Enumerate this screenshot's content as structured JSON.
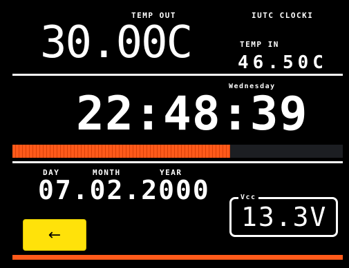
{
  "header": {
    "temp_out_label": "TEMP OUT",
    "clock_label": "IUTC CLOCKI",
    "temp_out_value": "30.00C",
    "temp_in_label": "TEMP IN",
    "temp_in_value": "46.50C"
  },
  "clock": {
    "weekday": "Wednesday",
    "time": "22:48:39",
    "progress_fraction": 0.66
  },
  "date": {
    "day_label": "DAY",
    "month_label": "MONTH",
    "year_label": "YEAR",
    "value": "07.02.2000"
  },
  "vcc": {
    "label": "Vcc",
    "value": "13.3V"
  },
  "back_button": {
    "icon": "left-arrow-icon",
    "glyph": "←"
  },
  "colors": {
    "background": "#000000",
    "text": "#ffffff",
    "progress": "#ff5a1a",
    "button": "#ffe20a"
  }
}
